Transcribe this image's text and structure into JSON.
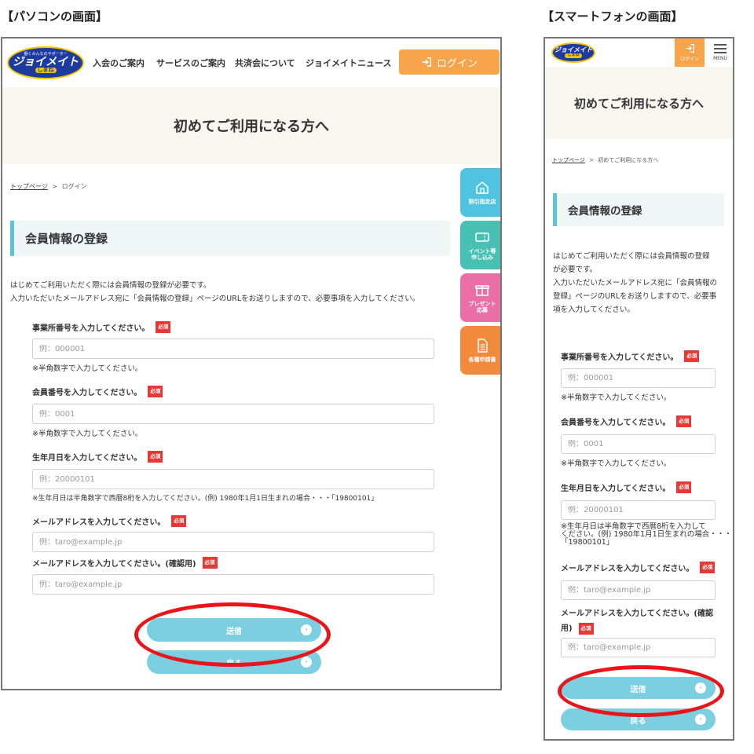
{
  "captions": {
    "pc": "【パソコンの画面】",
    "sp": "【スマートフォンの画面】"
  },
  "brand": {
    "logo_top": "働くみんなのサポーター",
    "logo_main": "ジョイメイト",
    "logo_sub": "しまね"
  },
  "nav": [
    "入会のご案内",
    "サービスのご案内",
    "共済会について",
    "ジョイメイトニュース"
  ],
  "login_label": "ログイン",
  "menu_label": "MENU",
  "hero_title": "初めてご利用になる方へ",
  "breadcrumb": {
    "pc_home": "トップページ",
    "pc_current": "ログイン",
    "sp_home": "トップページ",
    "sp_current": "初めてご利用になる方へ",
    "sep": ">"
  },
  "section_title": "会員情報の登録",
  "intro_pc": [
    "はじめてご利用いただく際には会員情報の登録が必要です。",
    "入力いただいたメールアドレス宛に「会員情報の登録」ページのURLをお送りしますので、必要事項を入力してください。"
  ],
  "intro_sp": [
    "はじめてご利用いただく際には会員情報の登録",
    "が必要です。",
    "入力いただいたメールアドレス宛に「会員情報の",
    "登録」ページのURLをお送りしますので、必要事",
    "項を入力してください。"
  ],
  "required_label": "必須",
  "fields": [
    {
      "label": "事業所番号を入力してください。",
      "placeholder": "例：000001",
      "hint": "※半角数字で入力してください。"
    },
    {
      "label": "会員番号を入力してください。",
      "placeholder": "例：0001",
      "hint": "※半角数字で入力してください。"
    },
    {
      "label": "生年月日を入力してください。",
      "placeholder": "例：20000101",
      "hint": "※生年月日は半角数字で西暦8桁を入力してください。(例) 1980年1月1日生まれの場合・・・「19800101」"
    },
    {
      "label": "メールアドレスを入力してください。",
      "placeholder": "例：taro@example.jp",
      "hint": ""
    },
    {
      "label": "メールアドレスを入力してください。(確認用)",
      "placeholder": "例：taro@example.jp",
      "hint": ""
    }
  ],
  "sp_birth_hint": [
    "※生年月日は半角数字で西暦8桁を入力して",
    "ください。(例) 1980年1月1日生まれの場合・・・",
    "「19800101」"
  ],
  "sp_confirm_label": [
    "メールアドレスを入力してください。(確認",
    "用)"
  ],
  "buttons": {
    "submit": "送信",
    "back": "戻る"
  },
  "side_tabs": [
    {
      "label": "割引指定店",
      "color": "#4fc3df",
      "icon": "store-icon"
    },
    {
      "label": "イベント等\n申し込み",
      "color": "#49c0b4",
      "icon": "ticket-icon"
    },
    {
      "label": "プレゼント\n応募",
      "color": "#ea6fa6",
      "icon": "gift-icon"
    },
    {
      "label": "各種申請書",
      "color": "#f18a3a",
      "icon": "document-icon"
    }
  ],
  "colors": {
    "accent_orange": "#f7a44b",
    "accent_cyan": "#7ccfe1",
    "required_red": "#e53935",
    "highlight_ring": "#e8151a"
  }
}
